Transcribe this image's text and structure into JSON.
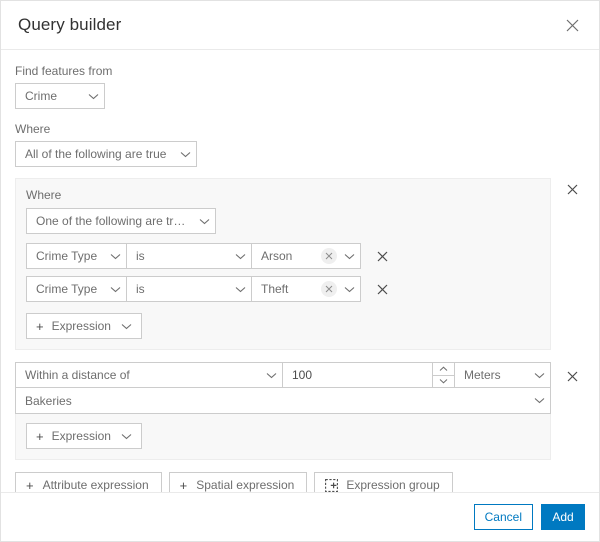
{
  "dialog": {
    "title": "Query builder",
    "close_icon": "close-icon"
  },
  "source": {
    "label": "Find features from",
    "value": "Crime"
  },
  "where": {
    "label": "Where",
    "value": "All of the following are true"
  },
  "group": {
    "label": "Where",
    "operator": "One of the following are tr…",
    "remove_icon": "close-icon",
    "conditions": [
      {
        "field": "Crime Type",
        "operator": "is",
        "value": "Arson",
        "clear_icon": "clear-icon",
        "remove_icon": "close-icon"
      },
      {
        "field": "Crime Type",
        "operator": "is",
        "value": "Theft",
        "clear_icon": "clear-icon",
        "remove_icon": "close-icon"
      }
    ],
    "add_expression": "Expression"
  },
  "spatial": {
    "relation": "Within a distance of",
    "distance": "100",
    "unit": "Meters",
    "layer": "Bakeries",
    "remove_icon": "close-icon",
    "add_expression": "Expression"
  },
  "add_buttons": {
    "attribute_expression": "Attribute expression",
    "spatial_expression": "Spatial expression",
    "expression_group": "Expression group",
    "group_icon": "expression-group-icon"
  },
  "footer": {
    "cancel": "Cancel",
    "add": "Add"
  },
  "colors": {
    "accent": "#0079c1",
    "panel_bg": "#f8f8f8",
    "border": "#cccccc",
    "text": "#6e6e6e",
    "title": "#323232"
  }
}
